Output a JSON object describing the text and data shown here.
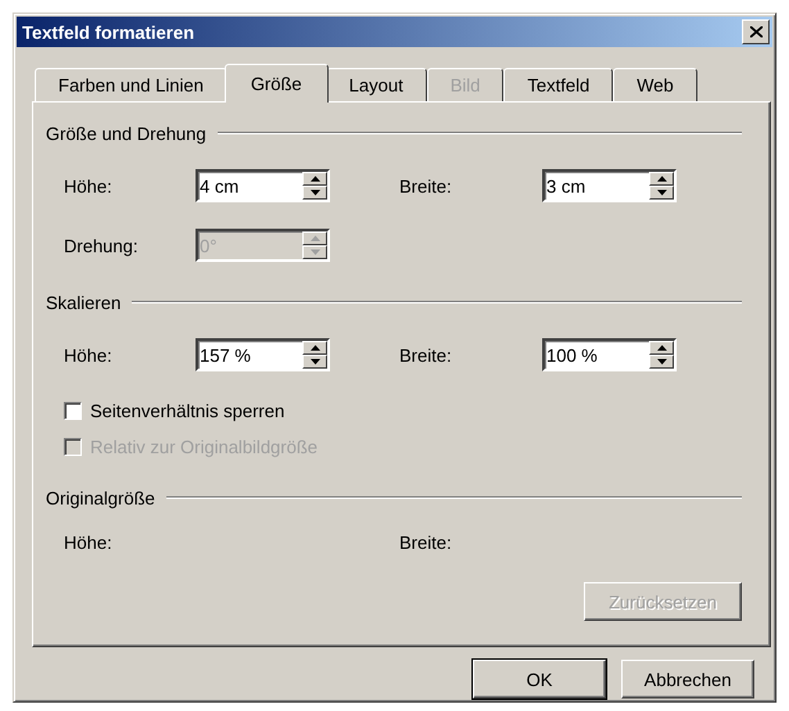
{
  "window": {
    "title": "Textfeld formatieren"
  },
  "tabs": [
    {
      "label": "Farben und Linien",
      "selected": false,
      "disabled": false
    },
    {
      "label": "Größe",
      "selected": true,
      "disabled": false
    },
    {
      "label": "Layout",
      "selected": false,
      "disabled": false
    },
    {
      "label": "Bild",
      "selected": false,
      "disabled": true
    },
    {
      "label": "Textfeld",
      "selected": false,
      "disabled": false
    },
    {
      "label": "Web",
      "selected": false,
      "disabled": false
    }
  ],
  "sections": [
    {
      "title": "Größe und Drehung",
      "rows": [
        [
          {
            "kind": "spin",
            "label": "Höhe:",
            "value": "4 cm",
            "disabled": false
          },
          {
            "kind": "spin",
            "label": "Breite:",
            "value": "3 cm",
            "disabled": false
          }
        ],
        [
          {
            "kind": "spin",
            "label": "Drehung:",
            "value": "0°",
            "disabled": true
          }
        ]
      ]
    },
    {
      "title": "Skalieren",
      "rows": [
        [
          {
            "kind": "spin",
            "label": "Höhe:",
            "value": "157 %",
            "disabled": false
          },
          {
            "kind": "spin",
            "label": "Breite:",
            "value": "100 %",
            "disabled": false
          }
        ]
      ],
      "checkboxes": [
        {
          "label": "Seitenverhältnis sperren",
          "checked": false,
          "disabled": false
        },
        {
          "label": "Relativ zur Originalbildgröße",
          "checked": false,
          "disabled": true
        }
      ]
    },
    {
      "title": "Originalgröße",
      "rows": [
        [
          {
            "kind": "label",
            "label": "Höhe:"
          },
          {
            "kind": "label",
            "label": "Breite:"
          }
        ]
      ]
    }
  ],
  "reset_button": {
    "label": "Zurücksetzen",
    "disabled": true
  },
  "buttons": [
    {
      "label": "OK",
      "default": true
    },
    {
      "label": "Abbrechen",
      "default": false
    }
  ]
}
